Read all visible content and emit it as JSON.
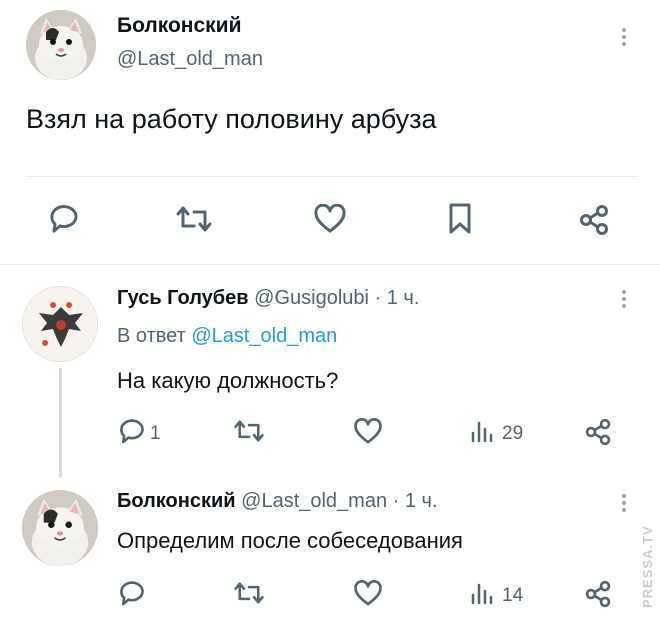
{
  "main_post": {
    "author_name": "Болконский",
    "author_handle": "@Last_old_man",
    "text": "Взял на работу половину арбуза",
    "actions": {
      "reply_icon": "reply-bubble-icon",
      "repost_icon": "repost-icon",
      "like_icon": "heart-icon",
      "bookmark_icon": "bookmark-icon",
      "share_icon": "share-icon"
    }
  },
  "replies": [
    {
      "author_name": "Гусь Голубев",
      "author_handle": "@Gusigolubi",
      "time": "· 1 ч.",
      "reply_to_prefix": "В ответ",
      "reply_to_handle": "@Last_old_man",
      "text": "На какую должность?",
      "reply_count": "1",
      "views_count": "29"
    },
    {
      "author_name": "Болконский",
      "author_handle": "@Last_old_man",
      "time": "· 1 ч.",
      "text": "Определим после собеседования",
      "views_count": "14"
    }
  ],
  "watermark": "PRESSA.TV",
  "colors": {
    "text": "#0f1419",
    "muted": "#536471",
    "link": "#1d9bf0",
    "divider": "#e7ebee",
    "icon": "#536471"
  }
}
